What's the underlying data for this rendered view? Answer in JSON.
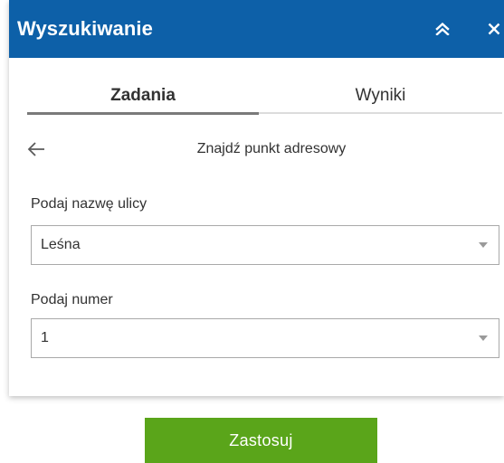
{
  "header": {
    "title": "Wyszukiwanie",
    "collapse_icon": "double-chevron-up-icon",
    "close_icon": "close-icon",
    "background_color": "#0d60a8"
  },
  "tabs": [
    {
      "label": "Zadania",
      "active": true
    },
    {
      "label": "Wyniki",
      "active": false
    }
  ],
  "task": {
    "back_icon": "arrow-left-icon",
    "title": "Znajdź punkt adresowy"
  },
  "form": {
    "street": {
      "label": "Podaj nazwę ulicy",
      "value": "Leśna"
    },
    "number": {
      "label": "Podaj numer",
      "value": "1"
    }
  },
  "actions": {
    "apply_label": "Zastosuj",
    "apply_color": "#5aa51a"
  }
}
